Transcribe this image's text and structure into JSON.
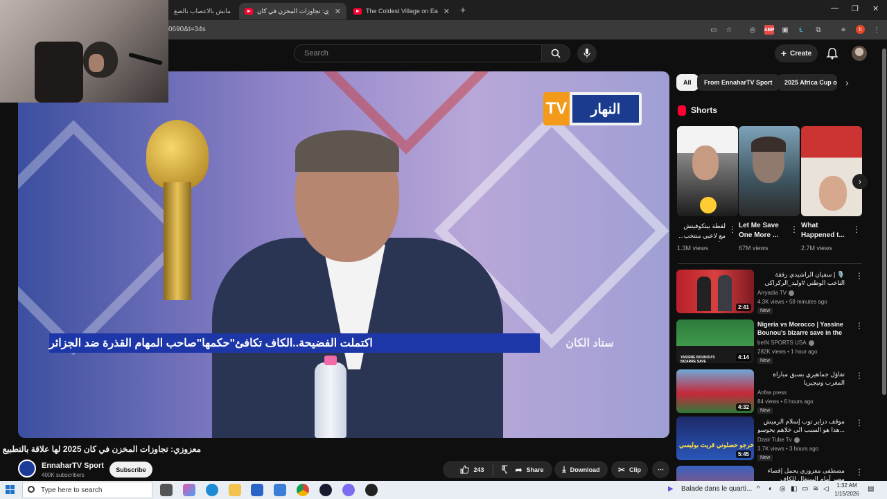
{
  "browser": {
    "tabs": [
      {
        "label": "مانش بالاعصاب بالضغ",
        "active": false
      },
      {
        "label": "معزوزي: تجاوزات المخزن في كان",
        "active": true
      },
      {
        "label": "The Coldest Village on Earth: O",
        "active": false
      }
    ],
    "new_tab": "+",
    "url": "0690&t=34s",
    "profile_initial": "h",
    "ext_badge": "ABP"
  },
  "youtube": {
    "search_placeholder": "Search",
    "create_label": "Create",
    "video": {
      "overlay_logo_name": "النهار",
      "overlay_logo_tv": "TV",
      "lower_third": "اكتملت الفضيحة..الكاف تكافئ\"حكمها\"صاحب المهام القذرة ضد الجزائر",
      "lower_third_brand": "ستاد الكان",
      "title": "معزوزي: تجاوزات المخزن في كان 2025 لها علاقة بالتطبيع",
      "channel": "EnnaharTV Sport",
      "subscribers": "400K subscribers",
      "subscribe_label": "Subscribe",
      "likes": "243",
      "share_label": "Share",
      "download_label": "Download",
      "clip_label": "Clip"
    },
    "chips": [
      "All",
      "From EnnaharTV Sport",
      "2025 Africa Cup o"
    ],
    "shorts_title": "Shorts",
    "shorts": [
      {
        "title": "لقطة بيتكوفيتش مع لاعبي منتخب... لا أحد يعرف سبب 😮 أعلق",
        "views": "1.3M views",
        "rtl": true
      },
      {
        "title": "Let Me Save One More ...",
        "views": "67M views",
        "rtl": false
      },
      {
        "title": "What Happened t...",
        "views": "2.7M views",
        "rtl": false
      }
    ],
    "videos": [
      {
        "title": "🎙️ | سفيان الراشيدي رفقة الناخب الوطني #وليد_الركراكي بعد مباراة نيجيريا",
        "channel": "Arryadia TV",
        "verified": true,
        "views": "4.3K views",
        "age": "58 minutes ago",
        "duration": "2:41",
        "new": "New",
        "rtl": true
      },
      {
        "title": "Nigeria vs Morocco | Yassine Bounou's bizarre save in the ...",
        "channel": "beIN SPORTS USA",
        "verified": true,
        "views": "282K views",
        "age": "1 hour ago",
        "duration": "4:14",
        "new": "New",
        "rtl": false,
        "thumb_text": "YASSINE BOUNOU'S BIZARRE SAVE"
      },
      {
        "title": "تفاؤل جماهيري بسبق مباراة المغرب ونيجيريا",
        "channel": "Anfas press",
        "verified": false,
        "views": "84 views",
        "age": "6 hours ago",
        "duration": "4:32",
        "new": "New",
        "rtl": true
      },
      {
        "title": "موقف دزاير توب إسلام الرميش ...هذا هو السبب الي خلاهم يحوسو خصوصا على",
        "channel": "Dzair Tube Tv",
        "verified": true,
        "views": "3.7K views",
        "age": "3 hours ago",
        "duration": "5:45",
        "new": "New",
        "rtl": true,
        "thumb_text": "خرجو حصلوني قريت بوليسي"
      },
      {
        "title": "مصطفى معزوزي يحمل إقصاء مصر أمام السنغال للكاف",
        "channel": "",
        "verified": false,
        "views": "",
        "age": "",
        "duration": "",
        "new": "",
        "rtl": true
      }
    ]
  },
  "taskbar": {
    "search_placeholder": "Type here to search",
    "weather_text": "Balade dans le quarti...",
    "time": "1:32 AM",
    "date": "1/15/2026"
  }
}
